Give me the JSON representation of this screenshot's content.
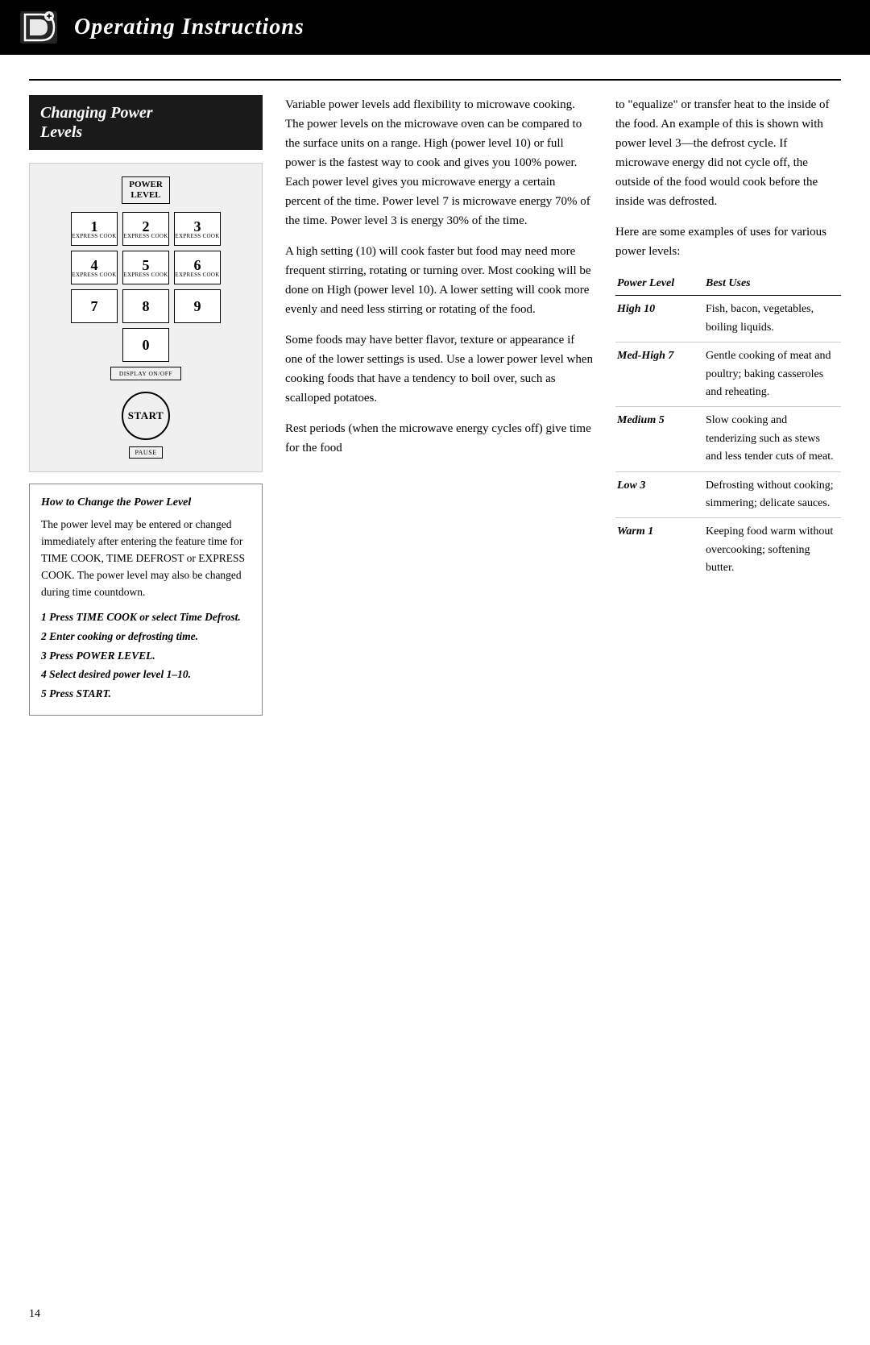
{
  "header": {
    "title": "Operating Instructions"
  },
  "section": {
    "heading_line1": "Changing Power",
    "heading_line2": "Levels"
  },
  "keypad": {
    "power_level_label_line1": "POWER",
    "power_level_label_line2": "LEVEL",
    "keys": [
      {
        "number": "1",
        "label": "EXPRESS COOK"
      },
      {
        "number": "2",
        "label": "EXPRESS COOK"
      },
      {
        "number": "3",
        "label": "EXPRESS COOK"
      },
      {
        "number": "4",
        "label": "EXPRESS COOK"
      },
      {
        "number": "5",
        "label": "EXPRESS COOK"
      },
      {
        "number": "6",
        "label": "EXPRESS COOK"
      },
      {
        "number": "7",
        "label": ""
      },
      {
        "number": "8",
        "label": ""
      },
      {
        "number": "9",
        "label": ""
      },
      {
        "number": "0",
        "label": ""
      }
    ],
    "display_label": "DISPLAY ON/OFF",
    "start_label": "START",
    "pause_label": "PAUSE"
  },
  "howto": {
    "heading": "How to Change the Power Level",
    "body": "The power level may be entered or changed immediately after entering the feature time for TIME COOK, TIME DEFROST or EXPRESS COOK. The power level may also be changed during time countdown.",
    "steps": [
      "1  Press TIME COOK or select Time Defrost.",
      "2  Enter cooking or defrosting time.",
      "3  Press POWER LEVEL.",
      "4  Select desired power level 1–10.",
      "5  Press START."
    ]
  },
  "col_left": {
    "paragraphs": [
      "Variable power levels add flexibility to microwave cooking. The power levels on the microwave oven can be compared to the surface units on a range. High (power level 10) or full power is the fastest way to cook and gives you 100% power. Each power level gives you microwave energy a certain percent of the time. Power level 7 is microwave energy 70% of the time. Power level 3 is energy 30% of the time.",
      "A high setting (10) will cook faster but food may need more frequent stirring, rotating or turning over. Most cooking will be done on High (power level 10). A lower setting will cook more evenly and need less stirring or rotating of the food.",
      "Some foods may have better flavor, texture or appearance if one of the lower settings is used. Use a lower power level when cooking foods that have a tendency to boil over, such as scalloped potatoes.",
      "Rest periods (when the microwave energy cycles off) give time for the food"
    ]
  },
  "col_right": {
    "intro_text": "to \"equalize\" or transfer heat to the inside of the food. An example of this is shown with power level 3—the defrost cycle. If microwave energy did not cycle off, the outside of the food would cook before the inside was defrosted.",
    "examples_text": "Here are some examples of uses for various power levels:",
    "table": {
      "headers": [
        "Power Level",
        "Best Uses"
      ],
      "rows": [
        {
          "level": "High 10",
          "uses": "Fish, bacon, vegetables, boiling liquids."
        },
        {
          "level": "Med-High 7",
          "uses": "Gentle cooking of meat and poultry; baking casseroles and reheating."
        },
        {
          "level": "Medium 5",
          "uses": "Slow cooking and tenderizing such as stews and less tender cuts of meat."
        },
        {
          "level": "Low 3",
          "uses": "Defrosting without cooking; simmering; delicate sauces."
        },
        {
          "level": "Warm 1",
          "uses": "Keeping food warm without overcooking; softening butter."
        }
      ]
    }
  },
  "page_number": "14"
}
